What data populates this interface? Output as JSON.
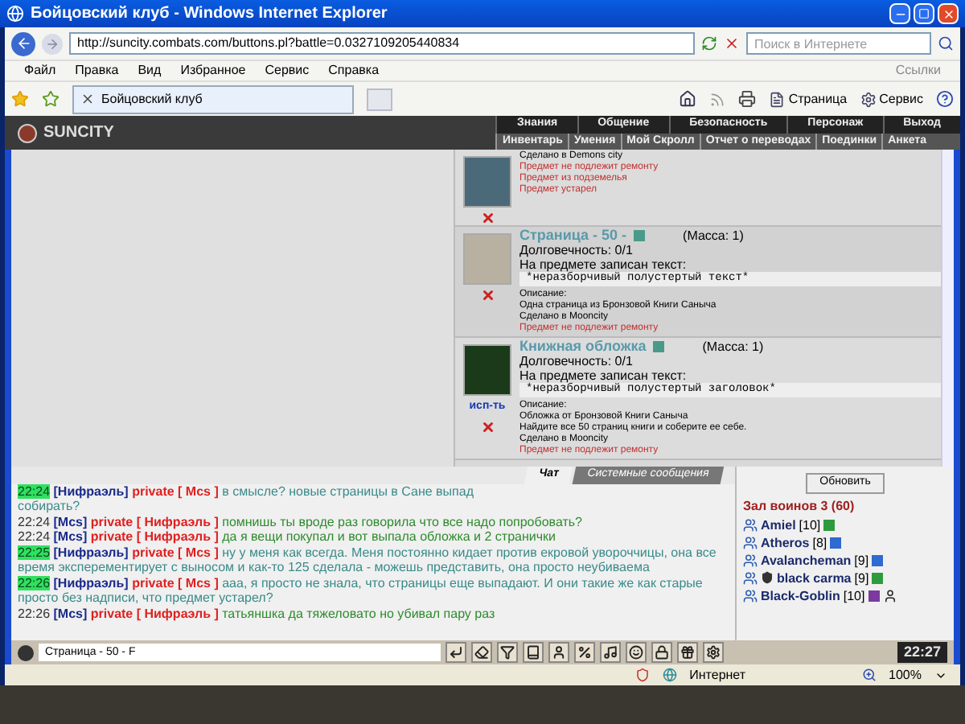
{
  "window": {
    "title": "Бойцовский клуб - Windows Internet Explorer"
  },
  "address_bar": {
    "url": "http://suncity.combats.com/buttons.pl?battle=0.0327109205440834",
    "search_placeholder": "Поиск в Интернете"
  },
  "menu": [
    "Файл",
    "Правка",
    "Вид",
    "Избранное",
    "Сервис",
    "Справка"
  ],
  "links_label": "Ссылки",
  "browser_tab": {
    "title": "Бойцовский клуб"
  },
  "command_bar": [
    "Страница",
    "Сервис"
  ],
  "game_header": {
    "logo": "SUNCITY",
    "nav_top": [
      "Знания",
      "Общение",
      "Безопасность",
      "Персонаж",
      "Выход"
    ],
    "nav_bottom": [
      "Инвентарь",
      "Умения",
      "Мой Скролл",
      "Отчет о переводах",
      "Поединки",
      "Анкета"
    ]
  },
  "items": [
    {
      "kind": "partial",
      "lines": [
        "Сделано в Demons city"
      ],
      "warnings": [
        "Предмет не подлежит ремонту",
        "Предмет из подземелья",
        "Предмет устарел"
      ]
    },
    {
      "kind": "full",
      "name": "Страница - 50 -",
      "mass": "(Масса: 1)",
      "durability": "Долговечность: 0/1",
      "text_label": "На предмете записан текст:",
      "text": "*неразборчивый полустертый текст*",
      "desc_label": "Описание:",
      "lines": [
        "Одна страница из Бронзовой Книги Саныча",
        "Сделано в Mooncity"
      ],
      "warnings": [
        "Предмет не подлежит ремонту"
      ]
    },
    {
      "kind": "full",
      "name": "Книжная обложка",
      "mass": "(Масса: 1)",
      "durability": "Долговечность: 0/1",
      "text_label": "На предмете записан текст:",
      "text": "*неразборчивый полустертый заголовок*",
      "desc_label": "Описание:",
      "lines": [
        "Обложка от Бронзовой Книги Саныча",
        "Найдите все 50 страниц книги и соберите ее себе.",
        "Сделано в Mooncity"
      ],
      "warnings": [
        "Предмет не подлежит ремонту"
      ],
      "action": "исп-ть"
    }
  ],
  "chat_tabs": [
    {
      "label": "Чат",
      "selected": true
    },
    {
      "label": "Системные сообщения",
      "selected": false
    }
  ],
  "messages": [
    {
      "time": "22:24",
      "highlighted": true,
      "sender": "[Нифраэль]",
      "private": "private [ Mcs ]",
      "text": "в смысле? новые страницы в Сане выпад",
      "continuation": "собирать?",
      "color": "#3a8a8a"
    },
    {
      "time": "22:24",
      "highlighted": false,
      "sender": "[Mcs]",
      "private": "private [ Нифраэль ]",
      "text": "помнишь ты вроде раз говорила что все надо попробовать?",
      "color": "#2e8b2e"
    },
    {
      "time": "22:24",
      "highlighted": false,
      "sender": "[Mcs]",
      "private": "private [ Нифраэль ]",
      "text": "да я вещи покупал и вот выпала обложка и 2 странички",
      "color": "#2e8b2e"
    },
    {
      "time": "22:25",
      "highlighted": true,
      "sender": "[Нифраэль]",
      "private": "private [ Mcs ]",
      "text": "ну у меня как всегда. Меня постоянно кидает против екровой увороччицы, она все время эксперементирует с выносом и как-то 125 сделала - можешь представить, она просто неубиваема",
      "color": "#3a8a8a"
    },
    {
      "time": "22:26",
      "highlighted": true,
      "sender": "[Нифраэль]",
      "private": "private [ Mcs ]",
      "text": "ааа, я просто не знала, что страницы еще выпадают. И они такие же как старые просто без надписи, что предмет устарел?",
      "color": "#3a8a8a"
    },
    {
      "time": "22:26",
      "highlighted": false,
      "sender": "[Mcs]",
      "private": "private [ Нифраэль ]",
      "text": "татьяншка да тяжеловато но убивал пару раз",
      "color": "#2e8b2e"
    }
  ],
  "refresh_button": "Обновить",
  "hall": {
    "title": "Зал воинов 3 (60)",
    "players": [
      {
        "name": "Amiel",
        "level": "[10]",
        "color": "#2e9a3e",
        "clan": false,
        "extra": false
      },
      {
        "name": "Atheros",
        "level": "[8]",
        "color": "#2e6ad0",
        "clan": false,
        "extra": false
      },
      {
        "name": "Avalancheman",
        "level": "[9]",
        "color": "#2e6ad0",
        "clan": false,
        "extra": false
      },
      {
        "name": "black carma",
        "level": "[9]",
        "color": "#2e9a3e",
        "clan": true,
        "extra": false
      },
      {
        "name": "Black-Goblin",
        "level": "[10]",
        "color": "#7a3aa0",
        "clan": false,
        "extra": true
      }
    ]
  },
  "chat_input": {
    "value": "Страница - 50 - F"
  },
  "clock": "22:27",
  "status_bar": {
    "zone": "Интернет",
    "zoom": "100%"
  }
}
